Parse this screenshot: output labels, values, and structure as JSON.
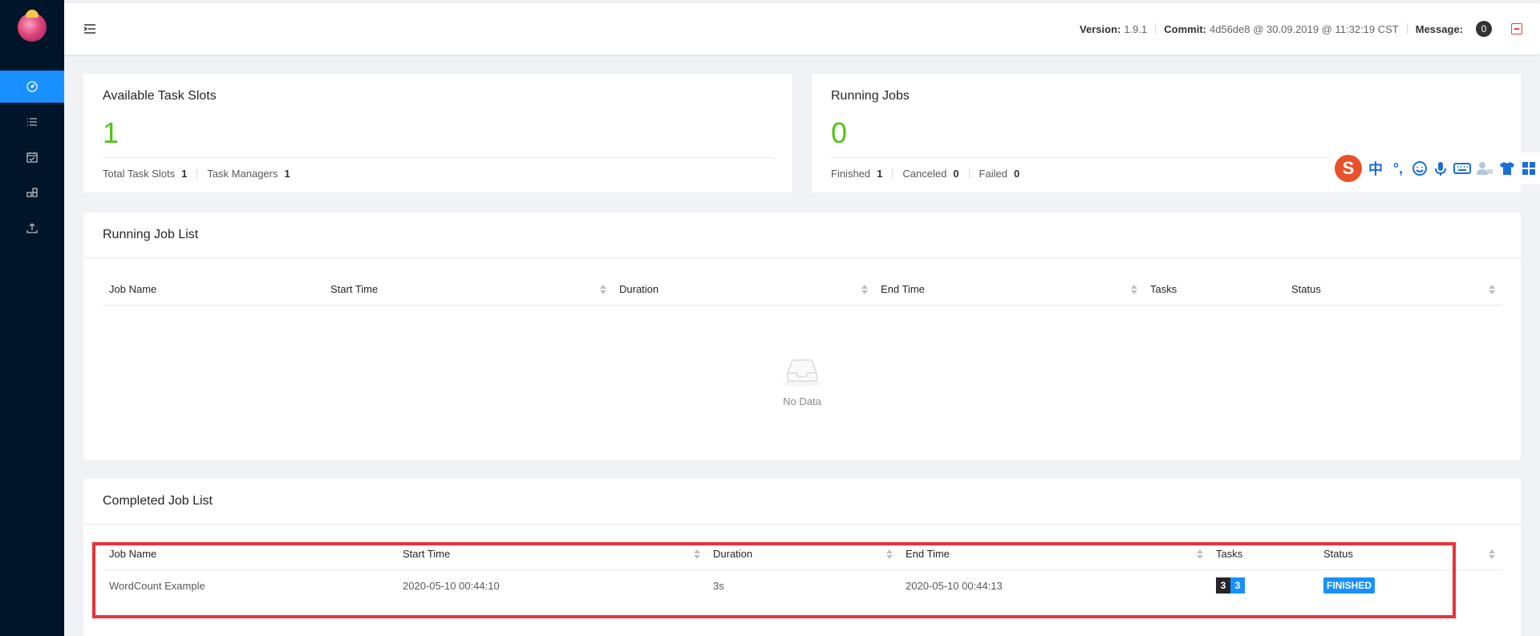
{
  "topbar": {
    "version_label": "Version:",
    "version_value": "1.9.1",
    "commit_label": "Commit:",
    "commit_value": "4d56de8 @ 30.09.2019 @ 11:32:19 CST",
    "message_label": "Message:",
    "message_count": "0"
  },
  "sidebar": {
    "items": [
      {
        "name": "overview",
        "icon": "dashboard-icon"
      },
      {
        "name": "jobs",
        "icon": "list-icon"
      },
      {
        "name": "task-managers",
        "icon": "calendar-icon"
      },
      {
        "name": "job-manager",
        "icon": "cluster-icon"
      },
      {
        "name": "submit",
        "icon": "upload-icon"
      }
    ]
  },
  "task_slots": {
    "title": "Available Task Slots",
    "value": "1",
    "total_label": "Total Task Slots",
    "total_value": "1",
    "managers_label": "Task Managers",
    "managers_value": "1"
  },
  "running_jobs": {
    "title": "Running Jobs",
    "value": "0",
    "finished_label": "Finished",
    "finished_value": "1",
    "canceled_label": "Canceled",
    "canceled_value": "0",
    "failed_label": "Failed",
    "failed_value": "0"
  },
  "running_list": {
    "title": "Running Job List",
    "columns": [
      "Job Name",
      "Start Time",
      "Duration",
      "End Time",
      "Tasks",
      "Status"
    ],
    "empty_text": "No Data"
  },
  "completed_list": {
    "title": "Completed Job List",
    "columns": [
      "Job Name",
      "Start Time",
      "Duration",
      "End Time",
      "Tasks",
      "Status"
    ],
    "rows": [
      {
        "job_name": "WordCount Example",
        "start_time": "2020-05-10 00:44:10",
        "duration": "3s",
        "end_time": "2020-05-10 00:44:13",
        "tasks_total": "3",
        "tasks_finished": "3",
        "status": "FINISHED"
      }
    ]
  },
  "ime": {
    "logo": "S",
    "items": [
      "中",
      "°,"
    ]
  },
  "colors": {
    "sidebar_bg": "#001529",
    "accent": "#1890ff",
    "success": "#52c41a",
    "highlight": "#e8333a"
  }
}
